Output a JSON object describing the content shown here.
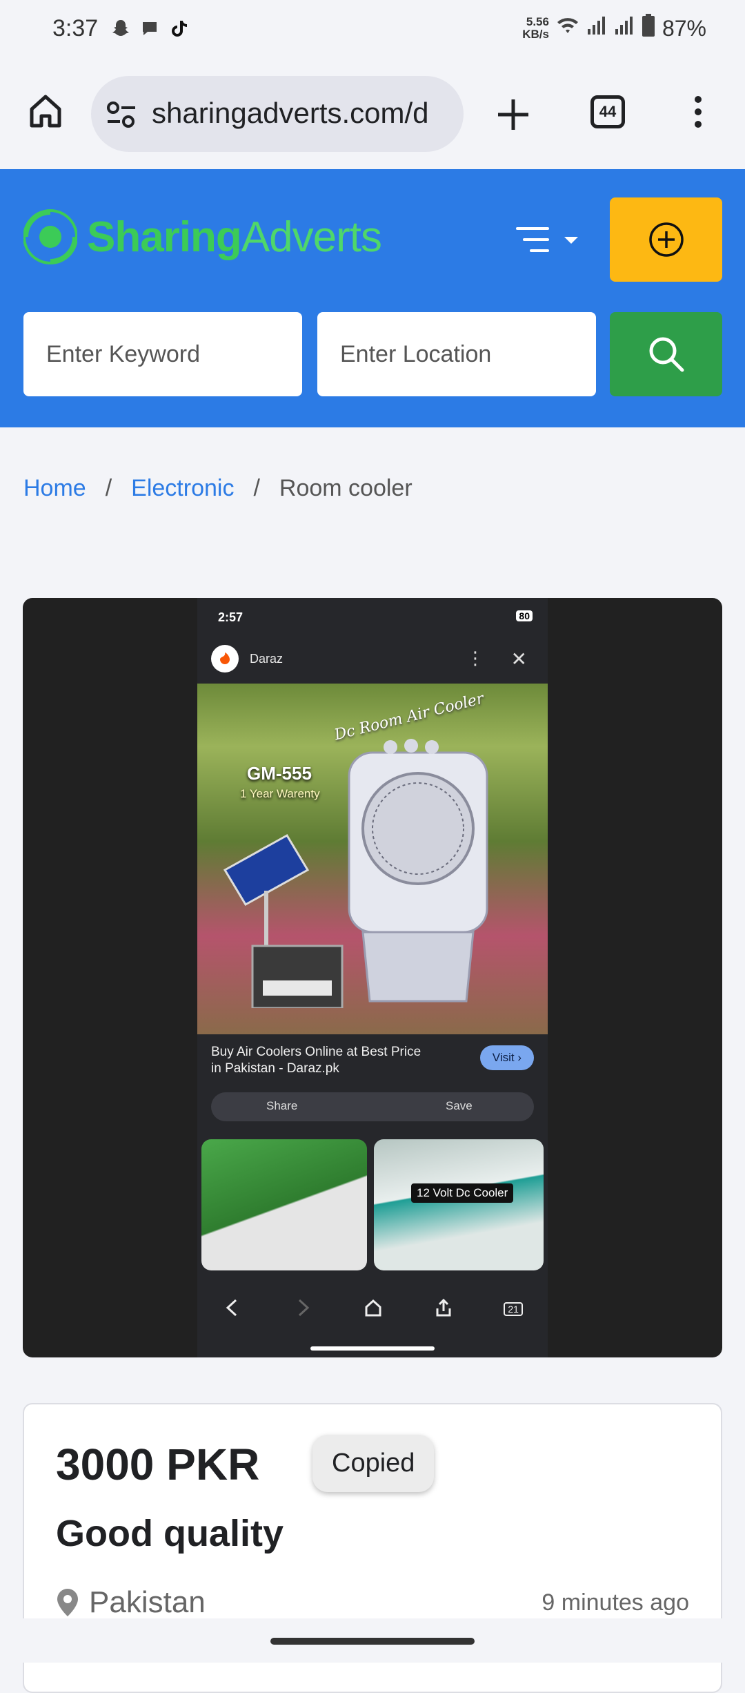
{
  "status_bar": {
    "time": "3:37",
    "speed": "5.56",
    "speed_unit": "KB/s",
    "battery": "87%"
  },
  "browser": {
    "url": "sharingadverts.com/d",
    "tab_count": "44"
  },
  "site": {
    "logo_part1": "Sharing",
    "logo_part2": "Adverts",
    "keyword_placeholder": "Enter Keyword",
    "location_placeholder": "Enter Location",
    "colors": {
      "header": "#2c7be5",
      "post": "#fdb813",
      "search": "#2e9e49"
    }
  },
  "breadcrumb": {
    "home": "Home",
    "category": "Electronic",
    "current": "Room cooler",
    "separator": "/"
  },
  "screenshot_image": {
    "time": "2:57",
    "battery": "80",
    "app_name": "Daraz",
    "product_name": "GM-555",
    "warranty": "1 Year Warenty",
    "script_text": "Dc Room Air Cooler",
    "result_title": "Buy Air Coolers Online at Best Price in Pakistan - Daraz.pk",
    "visit_label": "Visit",
    "share_label": "Share",
    "save_label": "Save",
    "thumb_label": "12 Volt Dc Cooler",
    "tabs_count": "21"
  },
  "listing": {
    "price": "3000 PKR",
    "copied_toast": "Copied",
    "title": "Good quality",
    "location": "Pakistan",
    "posted": "9 minutes ago"
  }
}
